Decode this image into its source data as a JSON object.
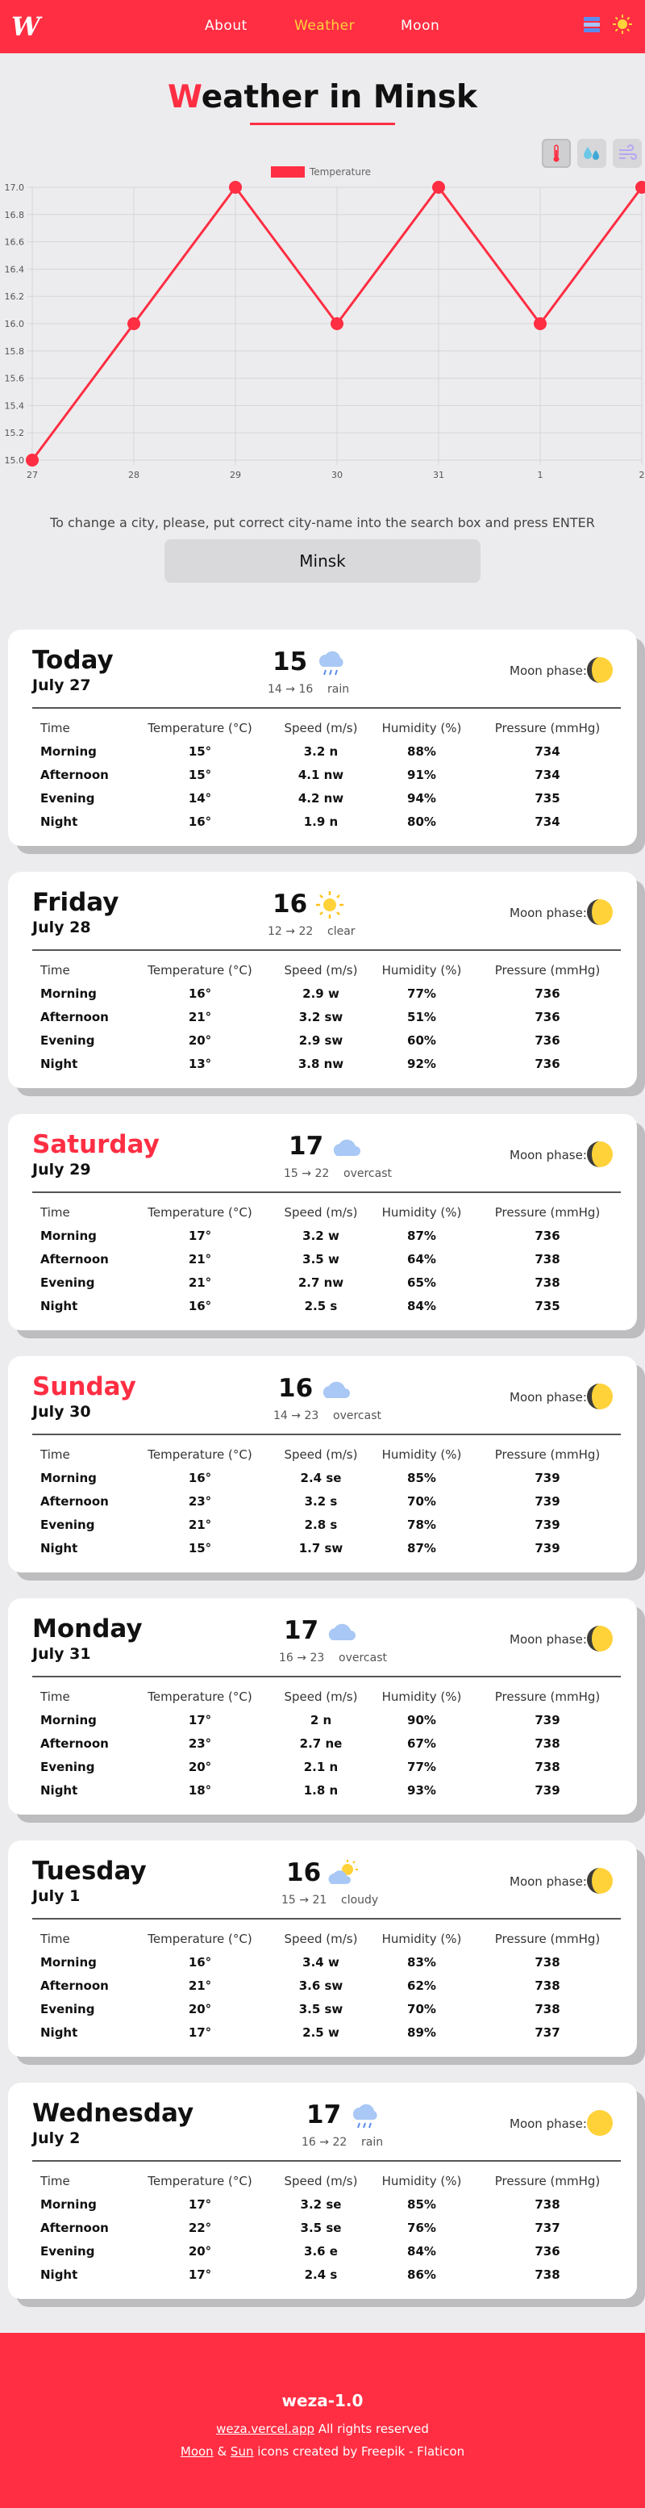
{
  "nav": {
    "logo": "W",
    "links": [
      "About",
      "Weather",
      "Moon"
    ],
    "active": "Weather"
  },
  "page": {
    "title_first": "W",
    "title_rest": "eather in Minsk"
  },
  "chart_controls": [
    "thermometer-icon",
    "humidity-drops-icon",
    "wind-icon"
  ],
  "chart_data": {
    "type": "line",
    "categories": [
      "27",
      "28",
      "29",
      "30",
      "31",
      "1",
      "2"
    ],
    "series": [
      {
        "name": "Temperature",
        "values": [
          15.0,
          16.0,
          17.0,
          16.0,
          17.0,
          16.0,
          17.0
        ]
      }
    ],
    "yticks": [
      "17.0",
      "16.8",
      "16.6",
      "16.4",
      "16.2",
      "16.0",
      "15.8",
      "15.6",
      "15.4",
      "15.2",
      "15.0"
    ],
    "ylim": [
      15.0,
      17.0
    ],
    "grid": true,
    "legend": "top-center",
    "color": "#ff2e43"
  },
  "search": {
    "hint": "To change a city, please, put correct city-name into the search box and press ENTER",
    "value": "Minsk"
  },
  "table_headers": [
    "Time",
    "Temperature (°C)",
    "Speed (m/s)",
    "Humidity (%)",
    "Pressure (mmHg)"
  ],
  "moon_label": "Moon phase:",
  "days": [
    {
      "name": "Today",
      "date": "July 27",
      "temp": "15",
      "range": "14 → 16",
      "cond": "rain",
      "icon": "rain-cloud-icon",
      "weekend": false,
      "moon": "waning-gibbous-moon-icon",
      "rows": [
        [
          "Morning",
          "15°",
          "3.2 n",
          "88%",
          "734"
        ],
        [
          "Afternoon",
          "15°",
          "4.1 nw",
          "91%",
          "734"
        ],
        [
          "Evening",
          "14°",
          "4.2 nw",
          "94%",
          "735"
        ],
        [
          "Night",
          "16°",
          "1.9 n",
          "80%",
          "734"
        ]
      ]
    },
    {
      "name": "Friday",
      "date": "July 28",
      "temp": "16",
      "range": "12 → 22",
      "cond": "clear",
      "icon": "sun-icon",
      "weekend": false,
      "moon": "waning-gibbous-moon-icon",
      "rows": [
        [
          "Morning",
          "16°",
          "2.9 w",
          "77%",
          "736"
        ],
        [
          "Afternoon",
          "21°",
          "3.2 sw",
          "51%",
          "736"
        ],
        [
          "Evening",
          "20°",
          "2.9 sw",
          "60%",
          "736"
        ],
        [
          "Night",
          "13°",
          "3.8 nw",
          "92%",
          "736"
        ]
      ]
    },
    {
      "name": "Saturday",
      "date": "July 29",
      "temp": "17",
      "range": "15 → 22",
      "cond": "overcast",
      "icon": "cloud-icon",
      "weekend": true,
      "moon": "waning-gibbous-moon-icon",
      "rows": [
        [
          "Morning",
          "17°",
          "3.2 w",
          "87%",
          "736"
        ],
        [
          "Afternoon",
          "21°",
          "3.5 w",
          "64%",
          "738"
        ],
        [
          "Evening",
          "21°",
          "2.7 nw",
          "65%",
          "738"
        ],
        [
          "Night",
          "16°",
          "2.5 s",
          "84%",
          "735"
        ]
      ]
    },
    {
      "name": "Sunday",
      "date": "July 30",
      "temp": "16",
      "range": "14 → 23",
      "cond": "overcast",
      "icon": "cloud-icon",
      "weekend": true,
      "moon": "waning-gibbous-moon-icon",
      "rows": [
        [
          "Morning",
          "16°",
          "2.4 se",
          "85%",
          "739"
        ],
        [
          "Afternoon",
          "23°",
          "3.2 s",
          "70%",
          "739"
        ],
        [
          "Evening",
          "21°",
          "2.8 s",
          "78%",
          "739"
        ],
        [
          "Night",
          "15°",
          "1.7 sw",
          "87%",
          "739"
        ]
      ]
    },
    {
      "name": "Monday",
      "date": "July 31",
      "temp": "17",
      "range": "16 → 23",
      "cond": "overcast",
      "icon": "cloud-icon",
      "weekend": false,
      "moon": "waning-gibbous-moon-icon",
      "rows": [
        [
          "Morning",
          "17°",
          "2 n",
          "90%",
          "739"
        ],
        [
          "Afternoon",
          "23°",
          "2.7 ne",
          "67%",
          "738"
        ],
        [
          "Evening",
          "20°",
          "2.1 n",
          "77%",
          "738"
        ],
        [
          "Night",
          "18°",
          "1.8 n",
          "93%",
          "739"
        ]
      ]
    },
    {
      "name": "Tuesday",
      "date": "July 1",
      "temp": "16",
      "range": "15 → 21",
      "cond": "cloudy",
      "icon": "sun-behind-cloud-icon",
      "weekend": false,
      "moon": "waning-gibbous-moon-icon",
      "rows": [
        [
          "Morning",
          "16°",
          "3.4 w",
          "83%",
          "738"
        ],
        [
          "Afternoon",
          "21°",
          "3.6 sw",
          "62%",
          "738"
        ],
        [
          "Evening",
          "20°",
          "3.5 sw",
          "70%",
          "738"
        ],
        [
          "Night",
          "17°",
          "2.5 w",
          "89%",
          "737"
        ]
      ]
    },
    {
      "name": "Wednesday",
      "date": "July 2",
      "temp": "17",
      "range": "16 → 22",
      "cond": "rain",
      "icon": "rain-cloud-icon",
      "weekend": false,
      "moon": "full-moon-icon",
      "rows": [
        [
          "Morning",
          "17°",
          "3.2 se",
          "85%",
          "738"
        ],
        [
          "Afternoon",
          "22°",
          "3.5 se",
          "76%",
          "737"
        ],
        [
          "Evening",
          "20°",
          "3.6 e",
          "84%",
          "736"
        ],
        [
          "Night",
          "17°",
          "2.4 s",
          "86%",
          "738"
        ]
      ]
    }
  ],
  "footer": {
    "brand": "weza-1.0",
    "site_link": "weza.vercel.app",
    "rights": " All rights reserved",
    "moon_link": "Moon",
    "amp": " & ",
    "sun_link": "Sun",
    "credit": " icons created by Freepik - Flaticon"
  }
}
